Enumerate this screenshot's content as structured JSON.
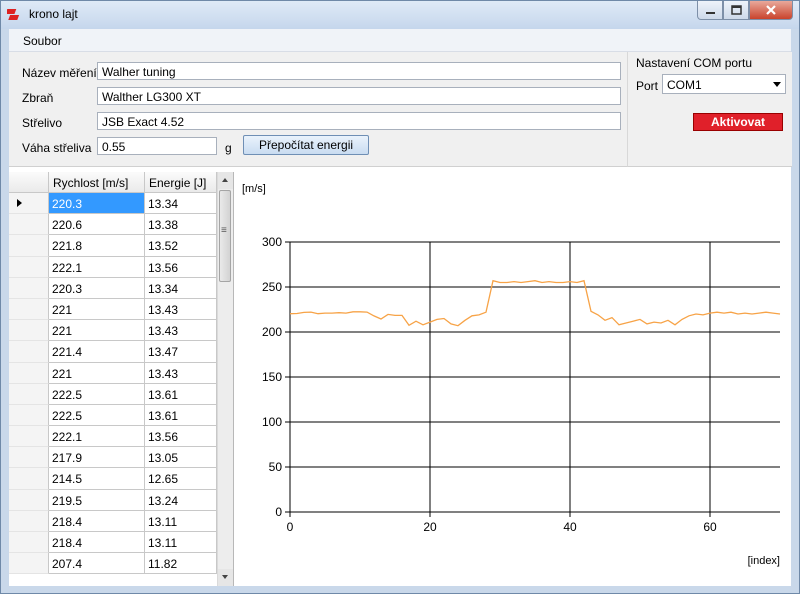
{
  "window": {
    "title": "krono lajt"
  },
  "menu": {
    "file_label": "Soubor"
  },
  "form": {
    "measurement_label": "Název měření",
    "measurement_value": "Walher tuning",
    "weapon_label": "Zbraň",
    "weapon_value": "Walther LG300 XT",
    "ammo_label": "Střelivo",
    "ammo_value": "JSB Exact 4.52",
    "weight_label": "Váha střeliva",
    "weight_value": "0.55",
    "weight_unit": "g",
    "recalc_label": "Přepočítat energii"
  },
  "com": {
    "title": "Nastavení COM portu",
    "port_label": "Port",
    "port_value": "COM1",
    "activate_label": "Aktivovat"
  },
  "grid": {
    "headers": [
      "Rychlost [m/s]",
      "Energie [J]"
    ],
    "rows": [
      [
        "220.3",
        "13.34"
      ],
      [
        "220.6",
        "13.38"
      ],
      [
        "221.8",
        "13.52"
      ],
      [
        "222.1",
        "13.56"
      ],
      [
        "220.3",
        "13.34"
      ],
      [
        "221",
        "13.43"
      ],
      [
        "221",
        "13.43"
      ],
      [
        "221.4",
        "13.47"
      ],
      [
        "221",
        "13.43"
      ],
      [
        "222.5",
        "13.61"
      ],
      [
        "222.5",
        "13.61"
      ],
      [
        "222.1",
        "13.56"
      ],
      [
        "217.9",
        "13.05"
      ],
      [
        "214.5",
        "12.65"
      ],
      [
        "219.5",
        "13.24"
      ],
      [
        "218.4",
        "13.11"
      ],
      [
        "218.4",
        "13.11"
      ],
      [
        "207.4",
        "11.82"
      ]
    ]
  },
  "colors": {
    "line": "#f7a347",
    "activate": "#e0202a",
    "selection": "#3399ff"
  },
  "chart_data": {
    "type": "line",
    "ylabel": "[m/s]",
    "xlabel": "[index]",
    "xlim": [
      0,
      70
    ],
    "ylim": [
      0,
      300
    ],
    "xticks": [
      0,
      20,
      40,
      60
    ],
    "yticks": [
      0,
      50,
      100,
      150,
      200,
      250,
      300
    ],
    "grid": true,
    "series": [
      {
        "x": [
          0,
          1,
          2,
          3,
          4,
          5,
          6,
          7,
          8,
          9,
          10,
          11,
          12,
          13,
          14,
          15,
          16,
          17,
          18,
          19,
          20,
          21,
          22,
          23,
          24,
          25,
          26,
          27,
          28,
          29,
          30,
          31,
          32,
          33,
          34,
          35,
          36,
          37,
          38,
          39,
          40,
          41,
          42,
          43,
          44,
          45,
          46,
          47,
          48,
          49,
          50,
          51,
          52,
          53,
          54,
          55,
          56,
          57,
          58,
          59,
          60,
          61,
          62,
          63,
          64,
          65,
          66,
          67,
          68,
          69,
          70
        ],
        "values": [
          220.3,
          220.6,
          221.8,
          222.1,
          220.3,
          221,
          221,
          221.4,
          221,
          222.5,
          222.5,
          222.1,
          217.9,
          214.5,
          219.5,
          218.4,
          218.4,
          207.4,
          212,
          208,
          211,
          214,
          215,
          209,
          207,
          213,
          218,
          219,
          222,
          257,
          255,
          255,
          256,
          255,
          256,
          257,
          255,
          256,
          255,
          255,
          256,
          255,
          257,
          223,
          219,
          213,
          216,
          208,
          210,
          212,
          214,
          209,
          211,
          210,
          213,
          208,
          214,
          218,
          220,
          219,
          221,
          222,
          221,
          222,
          220,
          221,
          220,
          221,
          222,
          221,
          220
        ]
      }
    ]
  }
}
